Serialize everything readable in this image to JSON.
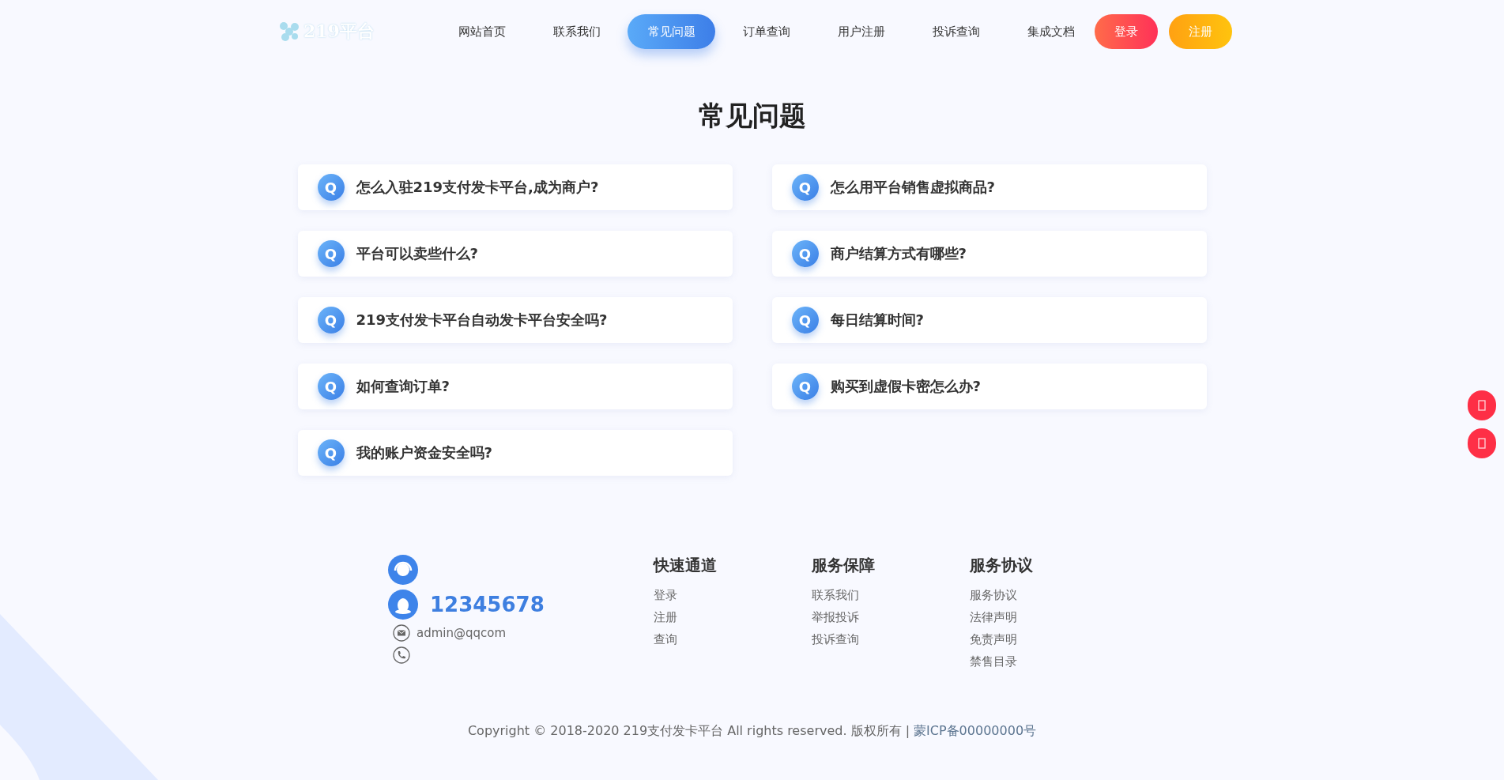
{
  "logo": {
    "text": "219平台"
  },
  "nav": [
    {
      "label": "网站首页",
      "selected": false
    },
    {
      "label": "联系我们",
      "selected": false
    },
    {
      "label": "常见问题",
      "selected": true
    },
    {
      "label": "订单查询",
      "selected": false
    },
    {
      "label": "用户注册",
      "selected": false
    },
    {
      "label": "投诉查询",
      "selected": false
    },
    {
      "label": "集成文档",
      "selected": false
    }
  ],
  "auth_buttons": [
    {
      "label": "登录",
      "kind": "login"
    },
    {
      "label": "注册",
      "kind": "register"
    }
  ],
  "page_title": "常见问题",
  "faq": [
    {
      "badge": "Q",
      "question": "怎么入驻219支付发卡平台,成为商户?"
    },
    {
      "badge": "Q",
      "question": "怎么用平台销售虚拟商品?"
    },
    {
      "badge": "Q",
      "question": "平台可以卖些什么?"
    },
    {
      "badge": "Q",
      "question": "商户结算方式有哪些?"
    },
    {
      "badge": "Q",
      "question": "219支付发卡平台自动发卡平台安全吗?"
    },
    {
      "badge": "Q",
      "question": "每日结算时间?"
    },
    {
      "badge": "Q",
      "question": "如何查询订单?"
    },
    {
      "badge": "Q",
      "question": "购买到虚假卡密怎么办?"
    },
    {
      "badge": "Q",
      "question": "我的账户资金安全吗?"
    }
  ],
  "contact": {
    "qq": "12345678",
    "email": "admin@qqcom"
  },
  "footer_columns": [
    {
      "title": "快速通道",
      "links": [
        "登录",
        "注册",
        "查询"
      ]
    },
    {
      "title": "服务保障",
      "links": [
        "联系我们",
        "举报投诉",
        "投诉查询"
      ]
    },
    {
      "title": "服务协议",
      "links": [
        "服务协议",
        "法律声明",
        "免责声明",
        "禁售目录"
      ]
    }
  ],
  "copyright": {
    "text": "Copyright © 2018-2020 219支付发卡平台 All rights reserved. 版权所有 |",
    "icp": "蒙ICP备00000000号"
  },
  "side_buttons": [
    {
      "kind": "square"
    },
    {
      "kind": "square"
    }
  ]
}
